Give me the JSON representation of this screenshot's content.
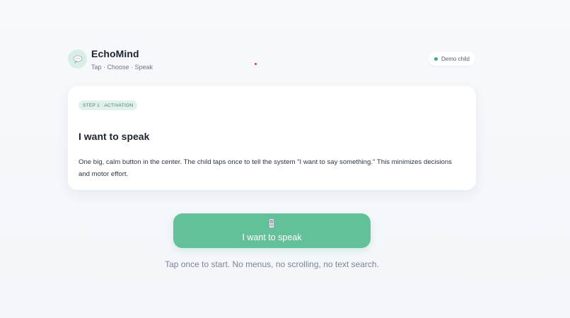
{
  "app": {
    "title": "EchoMind",
    "subtitle": "Tap · Choose · Speak",
    "logo_icon": "speech-bubble-icon",
    "brand_color": "#63c19a"
  },
  "status": {
    "label": "Demo child",
    "dot_color": "#3fae72"
  },
  "card": {
    "step_badge": "STEP 1 · ACTIVATION",
    "title": "I want to speak",
    "body": "One big, calm button in the center. The child taps once to tell the system \"I want to say something.\" This minimizes decisions and motor effort."
  },
  "action": {
    "button_label": "I want to speak",
    "button_icon": "phone-icon",
    "hint": "Tap once to start. No menus, no scrolling, no text search."
  }
}
